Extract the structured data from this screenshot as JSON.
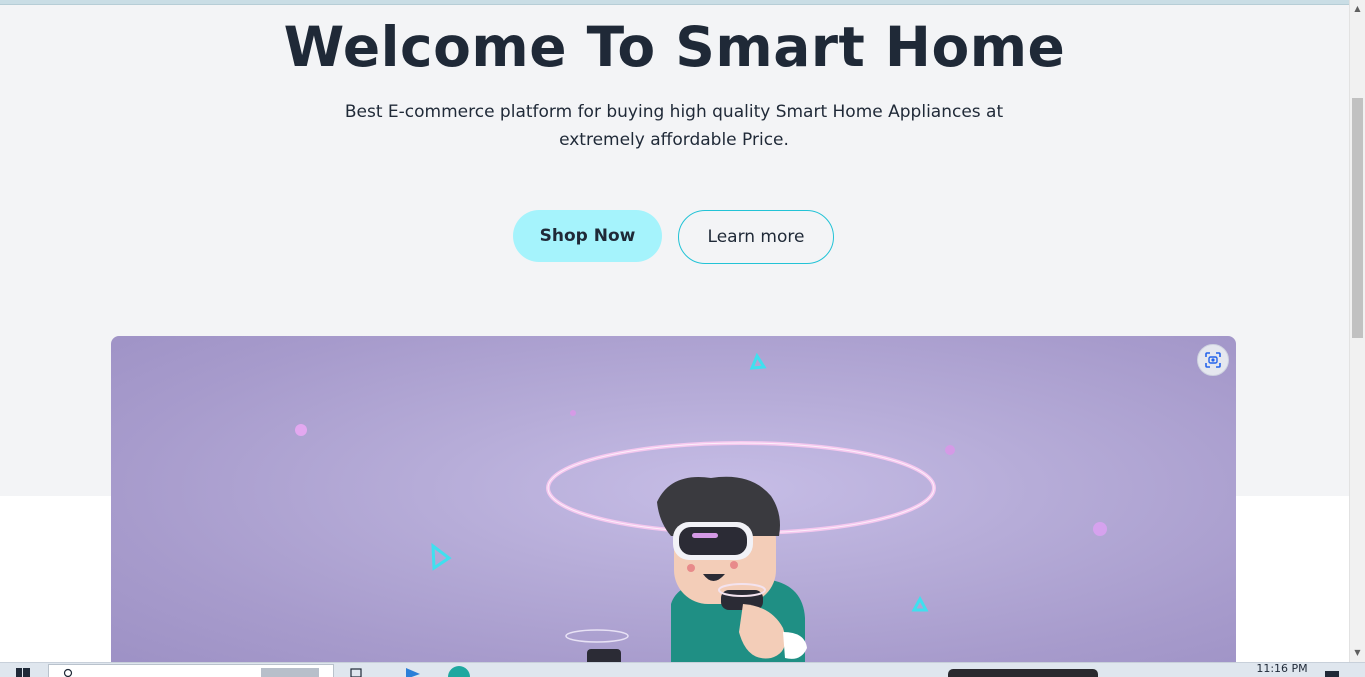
{
  "hero": {
    "title": "Welcome To Smart Home",
    "subtitle": "Best E-commerce platform for buying high quality Smart Home Appliances at extremely affordable Price.",
    "primary_button": "Shop Now",
    "secondary_button": "Learn more"
  },
  "image": {
    "action_icon": "screenshot-scan-icon"
  },
  "taskbar": {
    "clock": "11:16 PM",
    "icons": [
      "windows-start-icon",
      "search-icon",
      "task-view-icon",
      "media-player-icon",
      "edge-browser-icon",
      "notification-icon"
    ]
  },
  "colors": {
    "background": "#f3f4f6",
    "title_text": "#1f2937",
    "primary_button_bg": "#a5f3fc",
    "secondary_button_border": "#22c3d6",
    "hero_image_bg": "#b6acd8"
  }
}
